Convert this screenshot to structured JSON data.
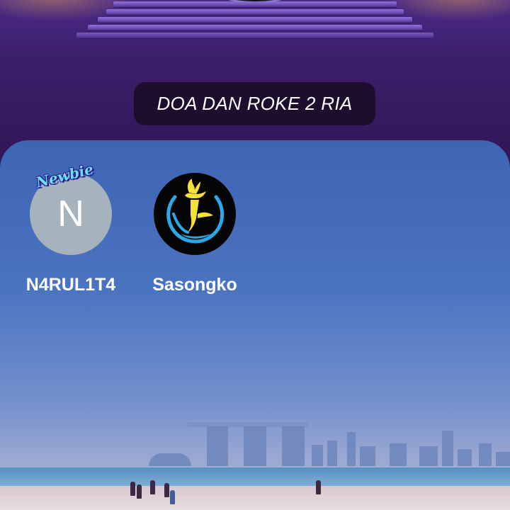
{
  "room": {
    "title": "DOA DAN ROKE 2 RIA"
  },
  "seats": [
    {
      "name": "N4RUL1T4",
      "avatar_initial": "N",
      "badge": "Newbie"
    },
    {
      "name": "Sasongko",
      "avatar_icon": "torch-logo-icon"
    }
  ],
  "colors": {
    "stage_bg": "#3c1f6b",
    "pill_bg": "#1c0e2c",
    "avatar_n_bg": "#a6b3bd",
    "badge_text": "#6fe0f0",
    "logo_yellow": "#f4e03a",
    "logo_blue": "#2aa8e8"
  }
}
